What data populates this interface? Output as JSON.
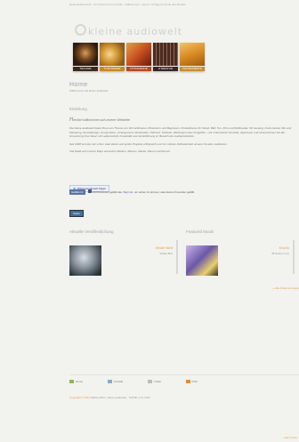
{
  "topbar": {
    "text": "kleineaudiowelt.de  ·  Ihr Portal rund um Audio  ·  Willkommen  ·  Heute: 12 Tage bis Ende des Monats"
  },
  "logo": {
    "text": "kleine audiowelt"
  },
  "categories": [
    {
      "label": "Technik",
      "color": "#3a2a1a"
    },
    {
      "label": "Tonträger",
      "color": "#c8891f"
    },
    {
      "label": "Fotografie",
      "color": "#b14a1e"
    },
    {
      "label": "Literatur",
      "color": "#3b2424"
    },
    {
      "label": "Instrumente",
      "color": "#cf8b2a"
    }
  ],
  "page": {
    "title": "Home",
    "breadcrumb": "Willkommen bei kleine audiowelt"
  },
  "intro": {
    "heading": "Einleitung",
    "welcome_initial": "H",
    "welcome_rest": "erzlich willkommen auf unserer Webseite",
    "paragraph1": "Die kleine audiowelt bietet Ihnen ein Thema von fünf erfahrenen Producern und Beginnern, Produktionen für Musik, Bild, Ton, Film und Multimedia. Ob Gesang, Instrumental, Mix und Mastering, Sounddesign, Komposition, Arrangement, Musikvideo, Hörbuch, Podcast, Werbespot oder Imagefilm – wir unterstützen Künstler, Agenturen und Unternehmen bei der Umsetzung ihrer Ideen mit Leidenschaft, Kreativität und viel Erfahrung im Bereich der Audioproduktion.",
    "paragraph2": "Seit 2008 konnten wir schon viele kleine und große Projekte erfolgreich und zur vollsten Zufriedenheit unserer Kunden realisieren.",
    "paragraph3": "Viel Spaß auf unserer Page wünschen Markus, Marcus, Daniel, Marco und Dennis."
  },
  "share": {
    "twitter_label": "@kleineaudiowelt folgen",
    "fb_like": "Gefällt mir",
    "fb_text_start": "244 Personen gefällt das.",
    "fb_signup": "Sign Up,",
    "fb_text_end": "um sehen zu können, was deinen Freunden gefällt.",
    "addthis_label": "Teilen"
  },
  "latest": {
    "heading": "Aktuelle Veröffentlichung",
    "item_name": "Wolke Bird",
    "item_sub": "Wolke Bird"
  },
  "featured": {
    "heading": "Featured Musik",
    "item_name": "Kosho",
    "item_sub": "48 Seiten Love"
  },
  "more_link": "» Alle Artikel anzeigen",
  "footer": {
    "home": "Home",
    "contact": "Kontakt",
    "imprint": "Inhalt",
    "rss": "RSS"
  },
  "copyright": {
    "prefix": "Copyright © 2011",
    "rest": "Markus Born, kleine audiowelt · XHTML 1.0 | CSS"
  },
  "bottom_link": "Nach oben"
}
